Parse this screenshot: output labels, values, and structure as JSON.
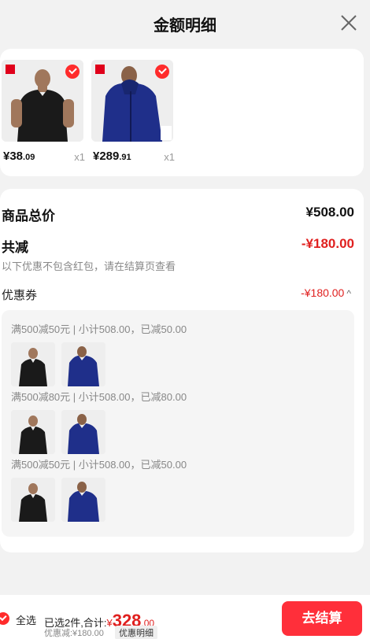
{
  "header": {
    "title": "金额明细"
  },
  "products": [
    {
      "price_int": "¥38",
      "price_dec": ".09",
      "qty": "x1",
      "image": "black-polo-shirt"
    },
    {
      "price_int": "¥289",
      "price_dec": ".91",
      "qty": "x1",
      "image": "navy-jacket"
    }
  ],
  "summary": {
    "goods_total_label": "商品总价",
    "goods_total_value": "¥508.00",
    "reduction_label": "共减",
    "reduction_value": "-¥180.00",
    "note": "以下优惠不包含红包，请在结算页查看",
    "coupon_label": "优惠券",
    "coupon_value": "-¥180.00",
    "coupon_caret": "^"
  },
  "coupon_groups": [
    {
      "desc": "满500减50元 | 小计508.00，已减50.00"
    },
    {
      "desc": "满500减80元 | 小计508.00，已减80.00"
    },
    {
      "desc": "满500减50元 | 小计508.00，已减50.00"
    }
  ],
  "bottom_bar": {
    "select_all": "全选",
    "selected_info": "已选2件,合计:",
    "currency": "¥",
    "total_int": "328",
    "total_dec": ".00",
    "discount": "优惠减:¥180.00",
    "detail_tag": "优惠明细",
    "checkout": "去结算"
  },
  "colors": {
    "accent": "#e0201f",
    "checkout_bg": "#ff2f3a"
  }
}
